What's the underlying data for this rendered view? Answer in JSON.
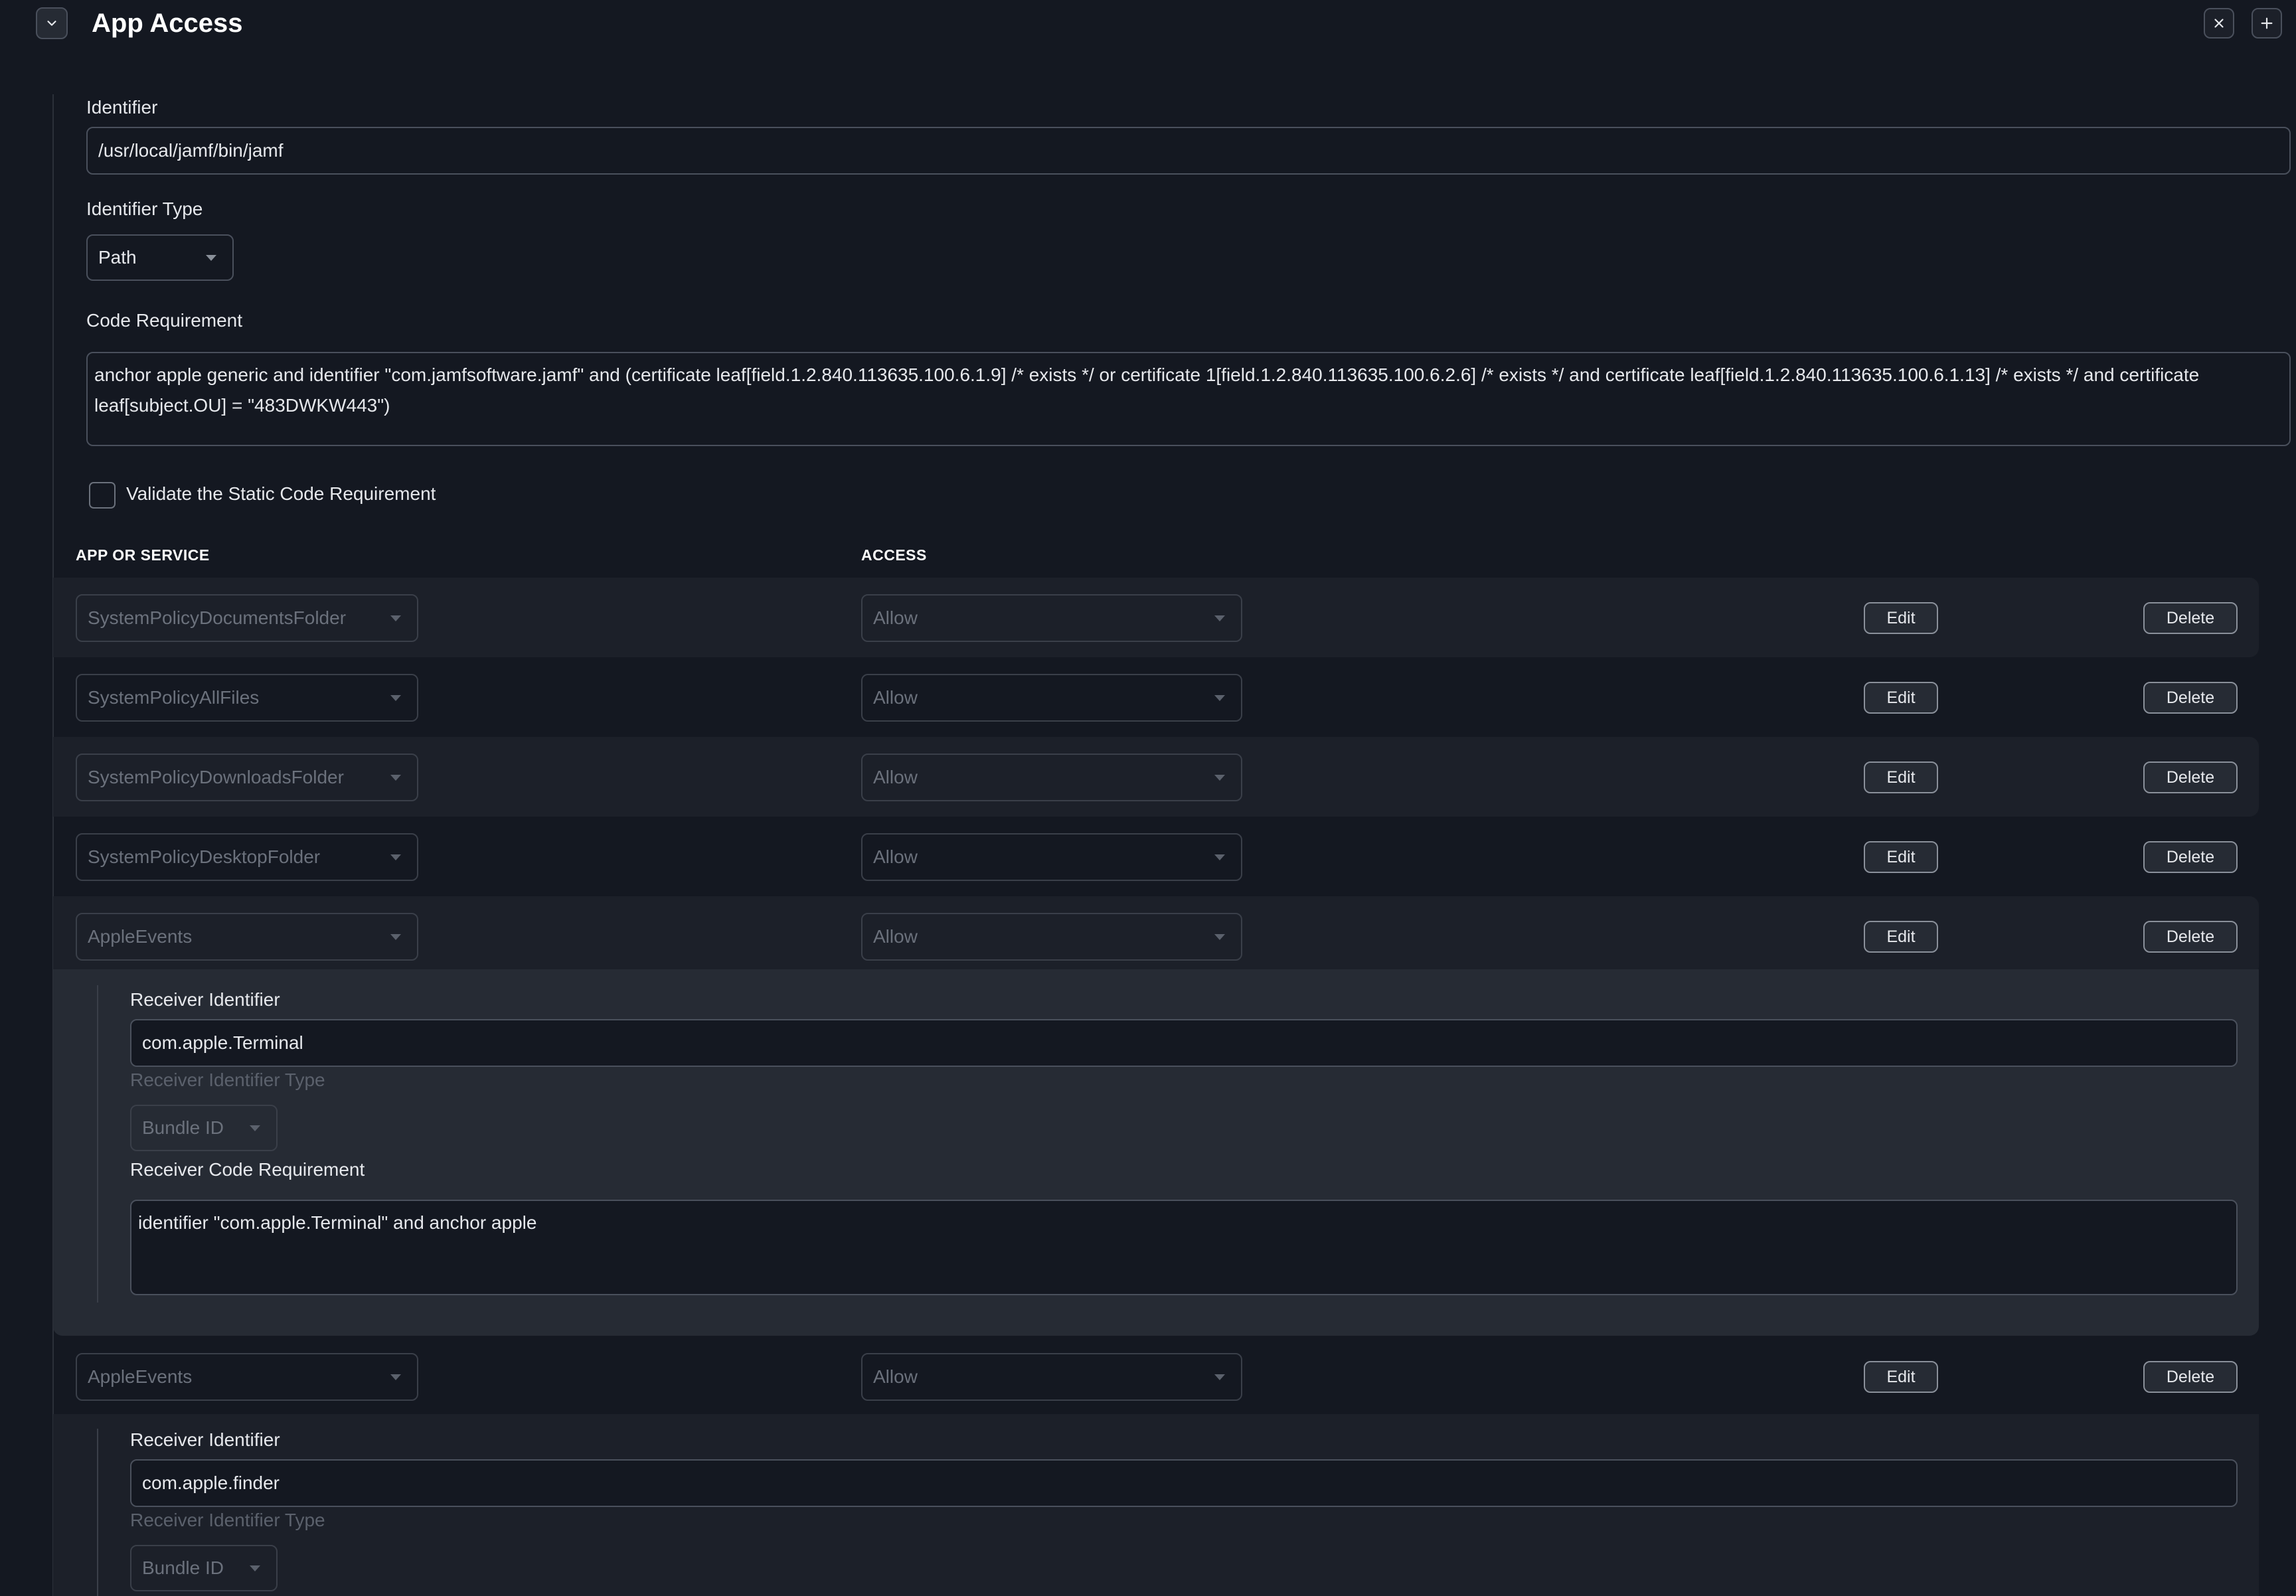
{
  "header": {
    "title": "App Access"
  },
  "identifier": {
    "label": "Identifier",
    "value": "/usr/local/jamf/bin/jamf"
  },
  "identifier_type": {
    "label": "Identifier Type",
    "value": "Path"
  },
  "code_requirement": {
    "label": "Code Requirement",
    "value": "anchor apple generic and identifier \"com.jamfsoftware.jamf\" and (certificate leaf[field.1.2.840.113635.100.6.1.9] /* exists */ or certificate 1[field.1.2.840.113635.100.6.2.6] /* exists */ and certificate leaf[field.1.2.840.113635.100.6.1.13] /* exists */ and certificate leaf[subject.OU] = \"483DWKW443\")"
  },
  "validate": {
    "label": "Validate the Static Code Requirement",
    "checked": false
  },
  "table": {
    "col_app": "APP OR SERVICE",
    "col_access": "ACCESS",
    "edit_label": "Edit",
    "delete_label": "Delete",
    "rows": [
      {
        "service": "SystemPolicyDocumentsFolder",
        "access": "Allow"
      },
      {
        "service": "SystemPolicyAllFiles",
        "access": "Allow"
      },
      {
        "service": "SystemPolicyDownloadsFolder",
        "access": "Allow"
      },
      {
        "service": "SystemPolicyDesktopFolder",
        "access": "Allow"
      },
      {
        "service": "AppleEvents",
        "access": "Allow"
      },
      {
        "service": "AppleEvents",
        "access": "Allow"
      }
    ]
  },
  "receivers": [
    {
      "identifier_label": "Receiver Identifier",
      "identifier_value": "com.apple.Terminal",
      "type_label": "Receiver Identifier Type",
      "type_value": "Bundle ID",
      "code_label": "Receiver Code Requirement",
      "code_value": "identifier \"com.apple.Terminal\" and anchor apple"
    },
    {
      "identifier_label": "Receiver Identifier",
      "identifier_value": "com.apple.finder",
      "type_label": "Receiver Identifier Type",
      "type_value": "Bundle ID"
    }
  ]
}
